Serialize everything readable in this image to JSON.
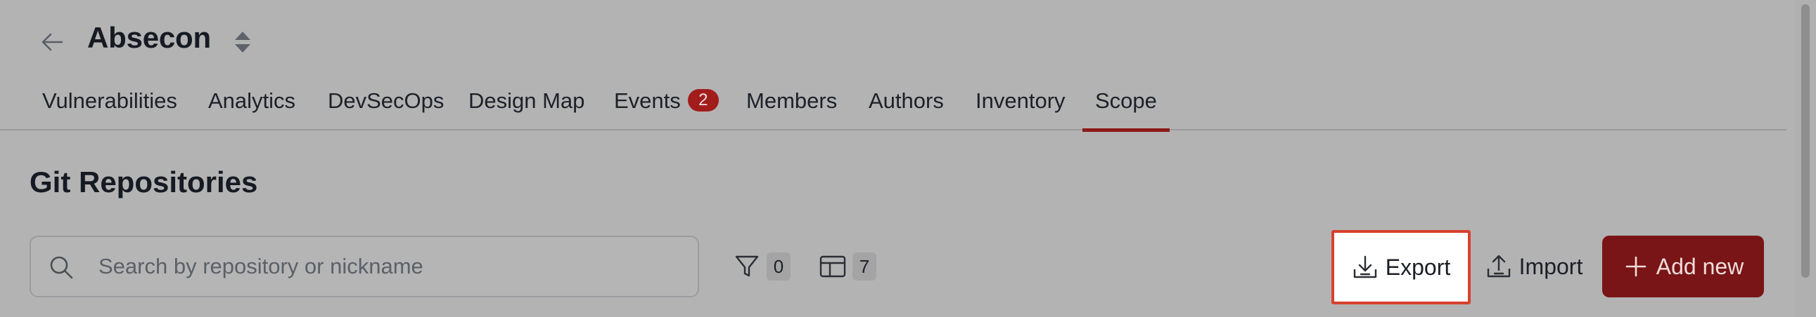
{
  "header": {
    "back_icon": "arrow-left-icon",
    "title": "Absecon",
    "switcher_icon": "sort-updown-icon"
  },
  "tabs": [
    {
      "label": "Vulnerabilities",
      "active": false
    },
    {
      "label": "Analytics",
      "active": false
    },
    {
      "label": "DevSecOps",
      "active": false
    },
    {
      "label": "Design Map",
      "active": false
    },
    {
      "label": "Events",
      "active": false,
      "badge": "2"
    },
    {
      "label": "Members",
      "active": false
    },
    {
      "label": "Authors",
      "active": false
    },
    {
      "label": "Inventory",
      "active": false
    },
    {
      "label": "Scope",
      "active": true
    }
  ],
  "section": {
    "title": "Git Repositories"
  },
  "toolbar": {
    "search_placeholder": "Search by repository or nickname",
    "search_value": "",
    "filter_count": "0",
    "columns_count": "7",
    "export_label": "Export",
    "import_label": "Import",
    "add_label": "Add new"
  },
  "colors": {
    "accent": "#791516",
    "active_tab_underline": "#8b1a1a",
    "badge": "#a21c1c",
    "highlight_border": "#d8412d"
  }
}
